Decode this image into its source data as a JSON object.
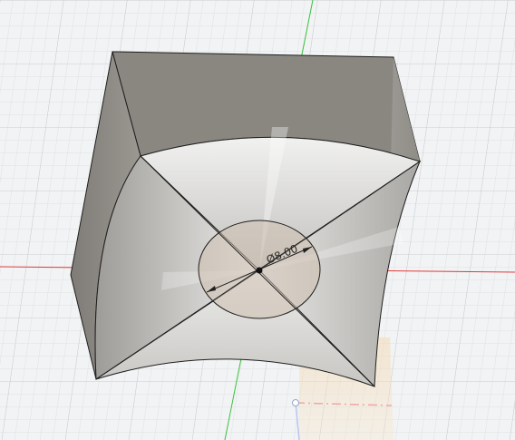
{
  "viewport": {
    "background": "#f2f3f4",
    "grid_color": "#d6d9dd",
    "grid_major_color": "#c6cacf"
  },
  "axes": {
    "x_color": "#e03a3a",
    "y_color": "#36c23a"
  },
  "model": {
    "body_color": "#8e8a84",
    "surface_light": "#e8e8e6",
    "circle_face_color": "#c9b9a4",
    "edge_color": "#1f1f1f"
  },
  "dimension": {
    "label": "Ø8.00"
  },
  "origin": {
    "icon": "origin-icon"
  }
}
